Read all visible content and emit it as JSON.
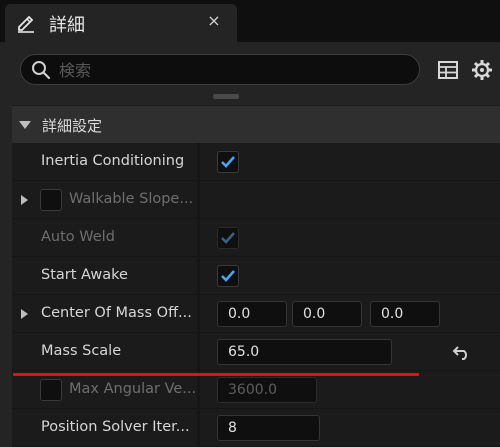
{
  "tab": {
    "title": "詳細",
    "close_label": "×"
  },
  "search": {
    "placeholder": "検索",
    "value": ""
  },
  "toolbar": {
    "icons": [
      "table-view-icon",
      "gear-icon"
    ]
  },
  "section": {
    "title": "詳細設定",
    "expanded": true
  },
  "rows": [
    {
      "label": "Inertia Conditioning",
      "type": "checkbox",
      "checked": true,
      "enabled": true
    },
    {
      "label": "Walkable Slope...",
      "type": "group",
      "expandable": true,
      "label_checkbox": true,
      "enabled": false
    },
    {
      "label": "Auto Weld",
      "type": "checkbox",
      "checked": true,
      "enabled": false
    },
    {
      "label": "Start Awake",
      "type": "checkbox",
      "checked": true,
      "enabled": true
    },
    {
      "label": "Center Of Mass Off...",
      "type": "vector",
      "expandable": true,
      "values": [
        "0.0",
        "0.0",
        "0.0"
      ]
    },
    {
      "label": "Mass Scale",
      "type": "number",
      "value": "65.0",
      "has_reset": true,
      "highlighted": true
    },
    {
      "label": "Max Angular Ve...",
      "type": "number",
      "value": "3600.0",
      "label_checkbox": true,
      "enabled": false
    },
    {
      "label": "Position Solver Iter...",
      "type": "number",
      "value": "8"
    }
  ],
  "colors": {
    "accent_check": "#4fa3f7",
    "highlight_underline": "#d01818",
    "panel_bg": "#242424",
    "field_bg": "#0f0f0f"
  }
}
